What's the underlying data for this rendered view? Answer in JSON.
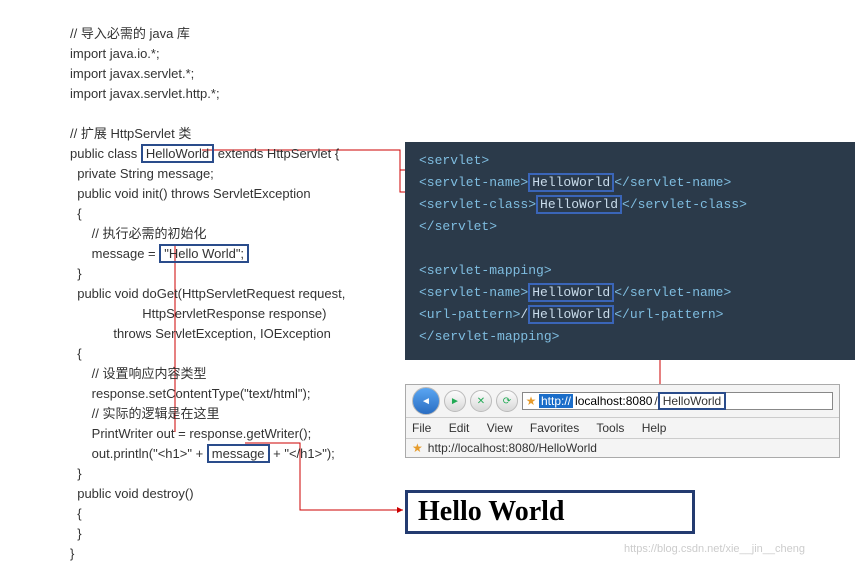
{
  "java": {
    "comment_import": "// 导入必需的 java 库",
    "import1": "import java.io.*;",
    "import2": "import javax.servlet.*;",
    "import3": "import javax.servlet.http.*;",
    "comment_extend": "// 扩展 HttpServlet 类",
    "class_pre": "public class ",
    "class_name": "HelloWorld",
    "class_post": "extends HttpServlet {",
    "field": "  private String message;",
    "init_sig": "  public void init() throws ServletException",
    "lbrace": "  {",
    "init_comment": "      // 执行必需的初始化",
    "msg_assign_pre": "      message = ",
    "msg_literal": "\"Hello World\";",
    "rbrace": "  }",
    "doget1": "  public void doGet(HttpServletRequest request,",
    "doget2": "                    HttpServletResponse response)",
    "doget3": "            throws ServletException, IOException",
    "lbrace2": "  {",
    "ct_comment": "      // 设置响应内容类型",
    "ct": "      response.setContentType(\"text/html\");",
    "logic_comment": "      // 实际的逻辑是在这里",
    "writer": "      PrintWriter out = response.getWriter();",
    "print_pre": "      out.println(\"<h1>\" + ",
    "print_mid": "message",
    "print_post": " + \"</h1>\");",
    "rbrace2": "  }",
    "destroy_sig": "  public void destroy()",
    "lbrace3": "  {",
    "rbrace3": "  }",
    "class_close": "}"
  },
  "xml": {
    "servlet_open": "<servlet>",
    "name_open": "    <servlet-name>",
    "name_val": "HelloWorld",
    "name_close": "</servlet-name>",
    "class_open": "    <servlet-class>",
    "class_val": "HelloWorld",
    "class_close_tag": "</servlet-class>",
    "servlet_close": "</servlet>",
    "map_open": "<servlet-mapping>",
    "map_name_open": "    <servlet-name>",
    "map_name_val": "HelloWorld",
    "map_name_close": "</servlet-name>",
    "url_open": "    <url-pattern>",
    "url_slash": "/",
    "url_val": "HelloWorld",
    "url_close": "</url-pattern>",
    "map_close": "</servlet-mapping>"
  },
  "browser": {
    "menu": {
      "file": "File",
      "edit": "Edit",
      "view": "View",
      "favorites": "Favorites",
      "tools": "Tools",
      "help": "Help"
    },
    "proto": "http://",
    "host": "localhost:8080",
    "slash": "/",
    "path": "HelloWorld",
    "tab_title": "http://localhost:8080/HelloWorld"
  },
  "output": {
    "text": "Hello World"
  },
  "watermark": "https://blog.csdn.net/xie__jin__cheng"
}
